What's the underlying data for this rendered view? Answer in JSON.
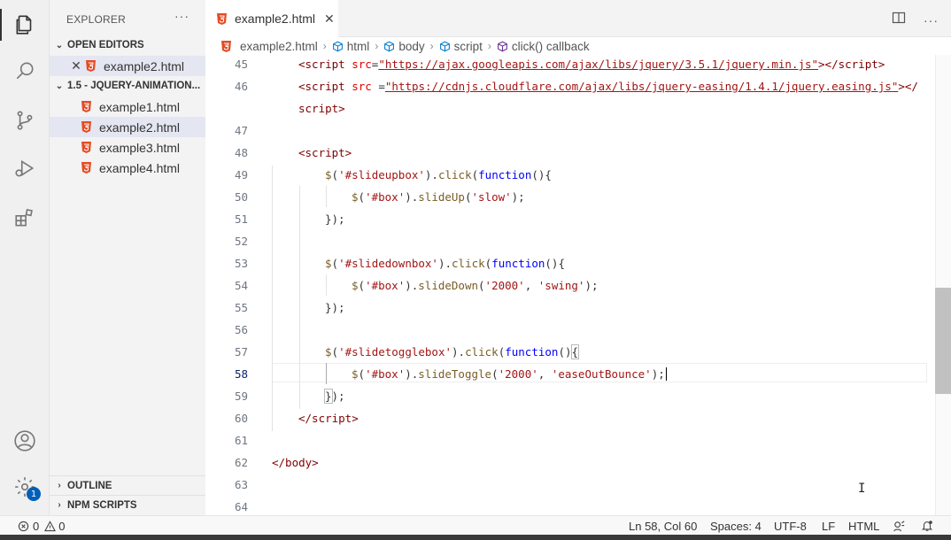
{
  "activity_bar": {
    "icons": [
      "files-icon",
      "search-icon",
      "source-control-icon",
      "run-debug-icon",
      "extensions-icon",
      "accounts-icon",
      "manage-gear-icon"
    ],
    "manage_badge": "1"
  },
  "explorer": {
    "title": "EXPLORER",
    "more": "···",
    "open_editors": {
      "label": "OPEN EDITORS",
      "files": [
        {
          "name": "example2.html"
        }
      ]
    },
    "folder": {
      "label": "1.5 - JQUERY-ANIMATION...",
      "files": [
        {
          "name": "example1.html"
        },
        {
          "name": "example2.html"
        },
        {
          "name": "example3.html"
        },
        {
          "name": "example4.html"
        }
      ]
    },
    "outline_label": "OUTLINE",
    "npm_label": "NPM SCRIPTS"
  },
  "tab": {
    "label": "example2.html",
    "close": "✕"
  },
  "breadcrumb": {
    "file": "example2.html",
    "items": [
      "html",
      "body",
      "script",
      "click() callback"
    ],
    "sep": "›"
  },
  "code": {
    "line_numbers": [
      "45",
      "46",
      "",
      "47",
      "48",
      "49",
      "50",
      "51",
      "52",
      "53",
      "54",
      "55",
      "56",
      "57",
      "58",
      "59",
      "60",
      "61",
      "62",
      "63",
      "64"
    ],
    "current_line": "58",
    "src1": "https://ajax.googleapis.com/ajax/libs/jquery/3.5.1/jquery.min.js",
    "src2": "https://cdnjs.cloudflare.com/ajax/libs/jquery-easing/1.4.1/jquery.easing.js",
    "sel_up": "'#slideupbox'",
    "sel_down": "'#slidedownbox'",
    "sel_toggle": "'#slidetogglebox'",
    "sel_box": "'#box'",
    "slow": "'slow'",
    "dur": "'2000'",
    "swing": "'swing'",
    "ease": "'easeOutBounce'"
  },
  "status_bar": {
    "errors": "0",
    "warnings": "0",
    "position": "Ln 58, Col 60",
    "spaces": "Spaces: 4",
    "encoding": "UTF-8",
    "eol": "LF",
    "language": "HTML"
  },
  "colors": {
    "accent": "#005fb8",
    "html_icon": "#e44d26"
  }
}
